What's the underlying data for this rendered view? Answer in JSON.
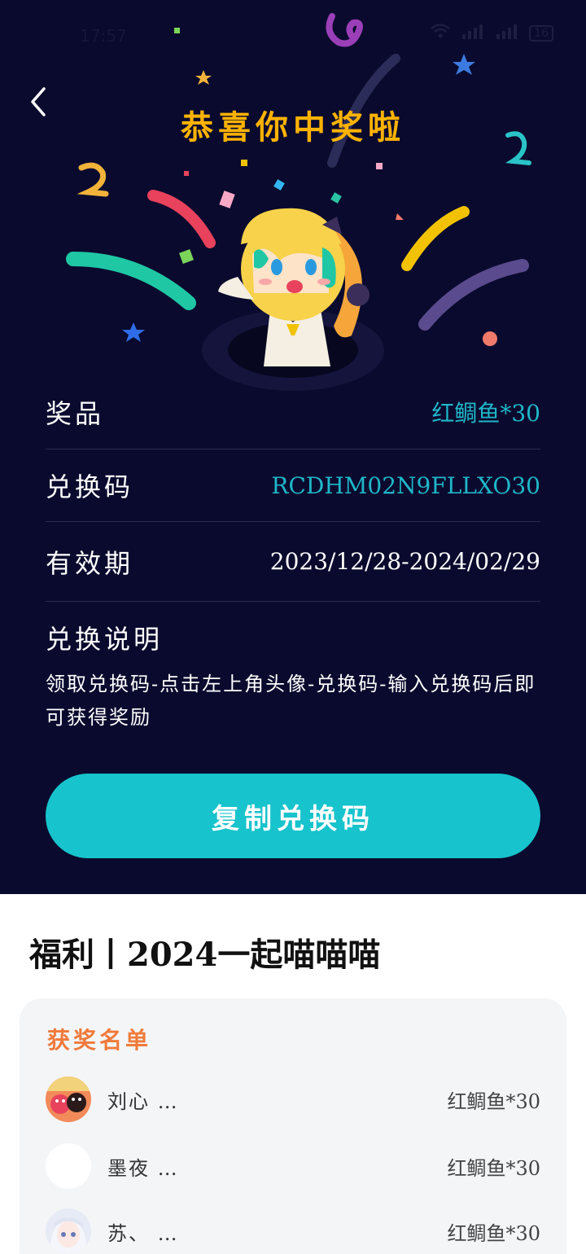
{
  "status_bar": {
    "time": "17:57",
    "battery": "16"
  },
  "hero": {
    "title": "恭喜你中奖啦"
  },
  "prize": {
    "label": "奖品",
    "value": "红鲷鱼*30"
  },
  "code": {
    "label": "兑换码",
    "value": "RCDHM02N9FLLXO30"
  },
  "validity": {
    "label": "有效期",
    "value": "2023/12/28-2024/02/29"
  },
  "instructions": {
    "title": "兑换说明",
    "text": "领取兑换码-点击左上角头像-兑换码-输入兑换码后即可获得奖励"
  },
  "copy_button": {
    "label": "复制兑换码"
  },
  "welfare": {
    "title": "福利丨2024一起喵喵喵"
  },
  "winners": {
    "title": "获奖名单",
    "list": [
      {
        "name": "刘心 …",
        "prize": "红鲷鱼*30"
      },
      {
        "name": "墨夜 …",
        "prize": "红鲷鱼*30"
      },
      {
        "name": "苏、 …",
        "prize": "红鲷鱼*30"
      }
    ]
  },
  "colors": {
    "hero_bg": "#0a0a2e",
    "accent_teal": "#17c3cc",
    "title_gold": "#ffb300",
    "winners_title": "#f07a3a"
  }
}
